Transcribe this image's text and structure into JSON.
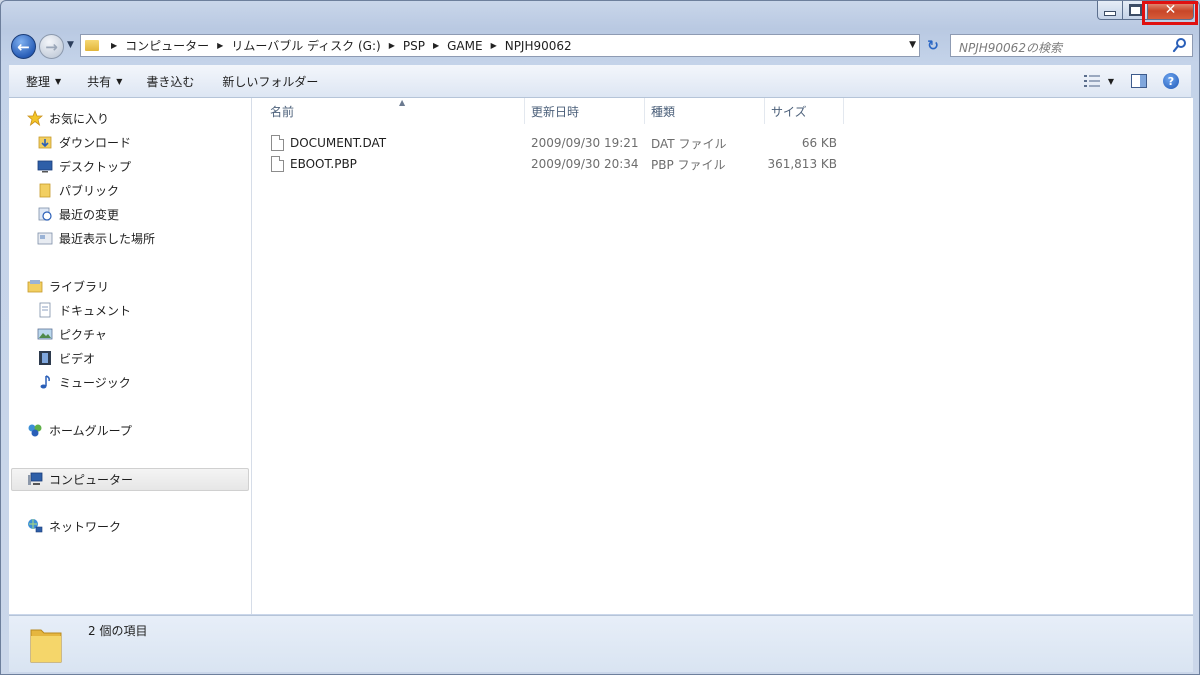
{
  "address": {
    "breadcrumbs": [
      "コンピューター",
      "リムーバブル ディスク (G:)",
      "PSP",
      "GAME",
      "NPJH90062"
    ]
  },
  "search": {
    "placeholder": "NPJH90062の検索"
  },
  "toolbar": {
    "organize_label": "整理",
    "share_label": "共有",
    "burn_label": "書き込む",
    "new_folder_label": "新しいフォルダー"
  },
  "sidebar": {
    "favorites": {
      "label": "お気に入り",
      "items": [
        {
          "label": "ダウンロード",
          "icon": "download-folder-icon"
        },
        {
          "label": "デスクトップ",
          "icon": "desktop-icon"
        },
        {
          "label": "パブリック",
          "icon": "folder-icon"
        },
        {
          "label": "最近の変更",
          "icon": "recent-changes-icon"
        },
        {
          "label": "最近表示した場所",
          "icon": "recent-places-icon"
        }
      ]
    },
    "libraries": {
      "label": "ライブラリ",
      "items": [
        {
          "label": "ドキュメント",
          "icon": "document-icon"
        },
        {
          "label": "ピクチャ",
          "icon": "picture-icon"
        },
        {
          "label": "ビデオ",
          "icon": "video-icon"
        },
        {
          "label": "ミュージック",
          "icon": "music-icon"
        }
      ]
    },
    "homegroup": {
      "label": "ホームグループ"
    },
    "computer": {
      "label": "コンピューター"
    },
    "network": {
      "label": "ネットワーク"
    }
  },
  "columns": [
    "名前",
    "更新日時",
    "種類",
    "サイズ"
  ],
  "files": [
    {
      "name": "DOCUMENT.DAT",
      "modified": "2009/09/30 19:21",
      "type": "DAT ファイル",
      "size": "66 KB"
    },
    {
      "name": "EBOOT.PBP",
      "modified": "2009/09/30 20:34",
      "type": "PBP ファイル",
      "size": "361,813 KB"
    }
  ],
  "status": {
    "item_count": "2 個の項目"
  },
  "colors": {
    "close_highlight": "#e01010",
    "window_frame": "#b9c9e2",
    "accent_blue": "#2a5fb8"
  }
}
